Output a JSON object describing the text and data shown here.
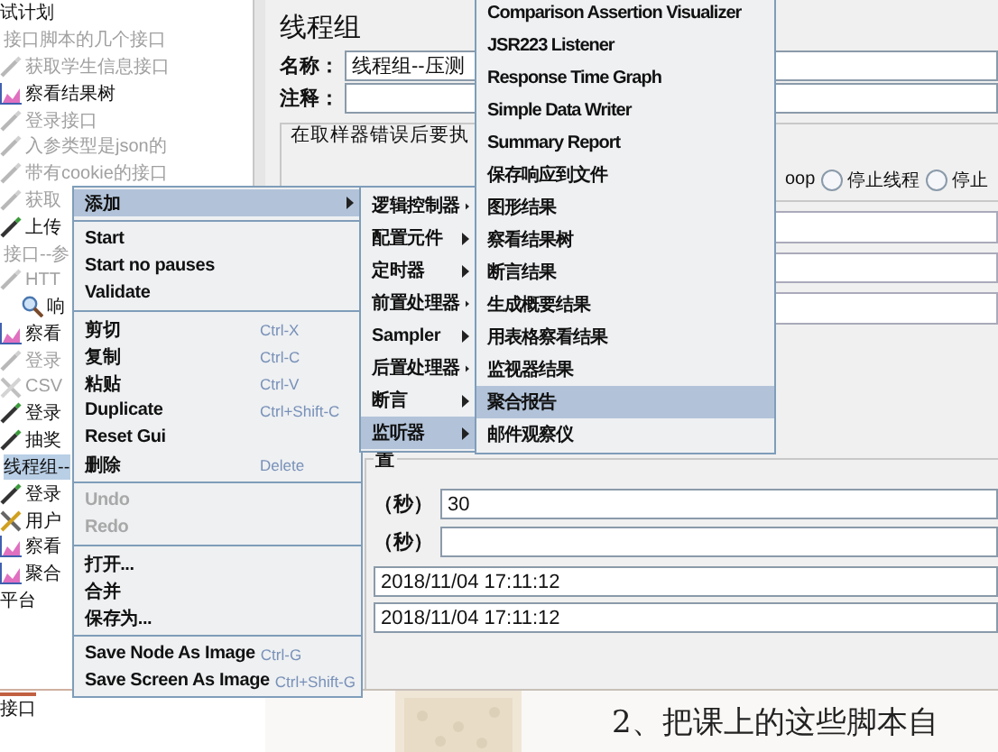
{
  "tree": {
    "items": [
      {
        "label": "试计划",
        "disabled": false,
        "selected": false,
        "children": [
          {
            "label": "接口脚本的几个接口",
            "disabled": true,
            "selected": false,
            "children": [
              {
                "label": "获取学生信息接口",
                "kind": "sampler",
                "disabled": true,
                "selected": false
              },
              {
                "label": "察看结果树",
                "kind": "listener",
                "disabled": false,
                "selected": false
              },
              {
                "label": "登录接口",
                "kind": "sampler",
                "disabled": true,
                "selected": false
              },
              {
                "label": "入参类型是json的",
                "kind": "sampler",
                "disabled": true,
                "selected": false
              },
              {
                "label": "带有cookie的接口",
                "kind": "sampler",
                "disabled": true,
                "selected": false
              },
              {
                "label": "获取",
                "kind": "sampler",
                "disabled": true,
                "selected": false
              },
              {
                "label": "上传",
                "kind": "sampler",
                "disabled": false,
                "selected": false
              }
            ]
          },
          {
            "label": "接口--参",
            "disabled": true,
            "selected": false,
            "children": [
              {
                "label": "HTT",
                "kind": "sampler",
                "disabled": true,
                "selected": false,
                "children": [
                  {
                    "label": "响",
                    "kind": "assertion",
                    "disabled": false,
                    "selected": false
                  }
                ]
              },
              {
                "label": "察看",
                "kind": "listener",
                "disabled": false,
                "selected": false
              },
              {
                "label": "登录",
                "kind": "sampler",
                "disabled": true,
                "selected": false
              },
              {
                "label": "CSV",
                "kind": "config",
                "disabled": true,
                "selected": false
              },
              {
                "label": "登录",
                "kind": "sampler",
                "disabled": false,
                "selected": false
              },
              {
                "label": "抽奖",
                "kind": "sampler",
                "disabled": false,
                "selected": false
              }
            ]
          },
          {
            "label": "线程组--",
            "disabled": false,
            "selected": true,
            "children": [
              {
                "label": "登录",
                "kind": "sampler",
                "disabled": false,
                "selected": false
              },
              {
                "label": "用户",
                "kind": "config",
                "disabled": false,
                "selected": false
              },
              {
                "label": "察看",
                "kind": "listener",
                "disabled": false,
                "selected": false
              },
              {
                "label": "聚合",
                "kind": "listener",
                "disabled": false,
                "selected": false
              }
            ]
          }
        ]
      },
      {
        "label": "平台",
        "disabled": false,
        "selected": false
      }
    ]
  },
  "bottom_tab": {
    "label": "接口"
  },
  "panel": {
    "title": "线程组",
    "name_label": "名称：",
    "name_value": "线程组--压测",
    "comment_label": "注释：",
    "error_group": {
      "title": "在取样器错误后要执",
      "option_fragment": "oop",
      "options": [
        {
          "label": "停止线程",
          "selected": false
        },
        {
          "label": "停止",
          "selected": false
        }
      ]
    },
    "thread_section": {
      "title": "置",
      "fields": [
        {
          "label": "（秒）",
          "value": "30"
        },
        {
          "label": "（秒）"
        }
      ],
      "dates": [
        "2018/11/04 17:11:12",
        "2018/11/04 17:11:12"
      ]
    }
  },
  "context_menu": {
    "items": [
      {
        "kind": "item",
        "label": "添加",
        "submenu": true,
        "selected": true,
        "disabled": false
      },
      {
        "kind": "separator"
      },
      {
        "kind": "item",
        "label": "Start",
        "selected": false,
        "disabled": false
      },
      {
        "kind": "item",
        "label": "Start no pauses",
        "selected": false,
        "disabled": false
      },
      {
        "kind": "item",
        "label": "Validate",
        "selected": false,
        "disabled": false
      },
      {
        "kind": "separator"
      },
      {
        "kind": "item",
        "label": "剪切",
        "shortcut": "Ctrl-X",
        "selected": false,
        "disabled": false
      },
      {
        "kind": "item",
        "label": "复制",
        "shortcut": "Ctrl-C",
        "selected": false,
        "disabled": false
      },
      {
        "kind": "item",
        "label": "粘贴",
        "shortcut": "Ctrl-V",
        "selected": false,
        "disabled": false
      },
      {
        "kind": "item",
        "label": "Duplicate",
        "shortcut": "Ctrl+Shift-C",
        "selected": false,
        "disabled": false
      },
      {
        "kind": "item",
        "label": "Reset Gui",
        "selected": false,
        "disabled": false
      },
      {
        "kind": "item",
        "label": "删除",
        "shortcut": "Delete",
        "selected": false,
        "disabled": false
      },
      {
        "kind": "separator"
      },
      {
        "kind": "item",
        "label": "Undo",
        "selected": false,
        "disabled": true
      },
      {
        "kind": "item",
        "label": "Redo",
        "selected": false,
        "disabled": true
      },
      {
        "kind": "separator"
      },
      {
        "kind": "item",
        "label": "打开...",
        "selected": false,
        "disabled": false
      },
      {
        "kind": "item",
        "label": "合并",
        "selected": false,
        "disabled": false
      },
      {
        "kind": "item",
        "label": "保存为...",
        "selected": false,
        "disabled": false
      },
      {
        "kind": "separator"
      },
      {
        "kind": "item",
        "label": "Save Node As Image",
        "shortcut": "Ctrl-G",
        "selected": false,
        "disabled": false
      },
      {
        "kind": "item",
        "label": "Save Screen As Image",
        "shortcut": "Ctrl+Shift-G",
        "selected": false,
        "disabled": false
      }
    ]
  },
  "add_submenu": {
    "items": [
      {
        "label": "逻辑控制器",
        "selected": false
      },
      {
        "label": "配置元件",
        "selected": false
      },
      {
        "label": "定时器",
        "selected": false
      },
      {
        "label": "前置处理器",
        "selected": false
      },
      {
        "label": "Sampler",
        "selected": false
      },
      {
        "label": "后置处理器",
        "selected": false
      },
      {
        "label": "断言",
        "selected": false
      },
      {
        "label": "监听器",
        "selected": true
      }
    ]
  },
  "listener_submenu": {
    "items": [
      {
        "label": "Comparison Assertion Visualizer",
        "selected": false
      },
      {
        "label": "JSR223 Listener",
        "selected": false
      },
      {
        "label": "Response Time Graph",
        "selected": false
      },
      {
        "label": "Simple Data Writer",
        "selected": false
      },
      {
        "label": "Summary Report",
        "selected": false
      },
      {
        "label": "保存响应到文件",
        "selected": false
      },
      {
        "label": "图形结果",
        "selected": false
      },
      {
        "label": "察看结果树",
        "selected": false
      },
      {
        "label": "断言结果",
        "selected": false
      },
      {
        "label": "生成概要结果",
        "selected": false
      },
      {
        "label": "用表格察看结果",
        "selected": false
      },
      {
        "label": "监视器结果",
        "selected": false
      },
      {
        "label": "聚合报告",
        "selected": true
      },
      {
        "label": "邮件观察仪",
        "selected": false
      }
    ]
  },
  "document": {
    "text": "2、把课上的这些脚本自"
  }
}
